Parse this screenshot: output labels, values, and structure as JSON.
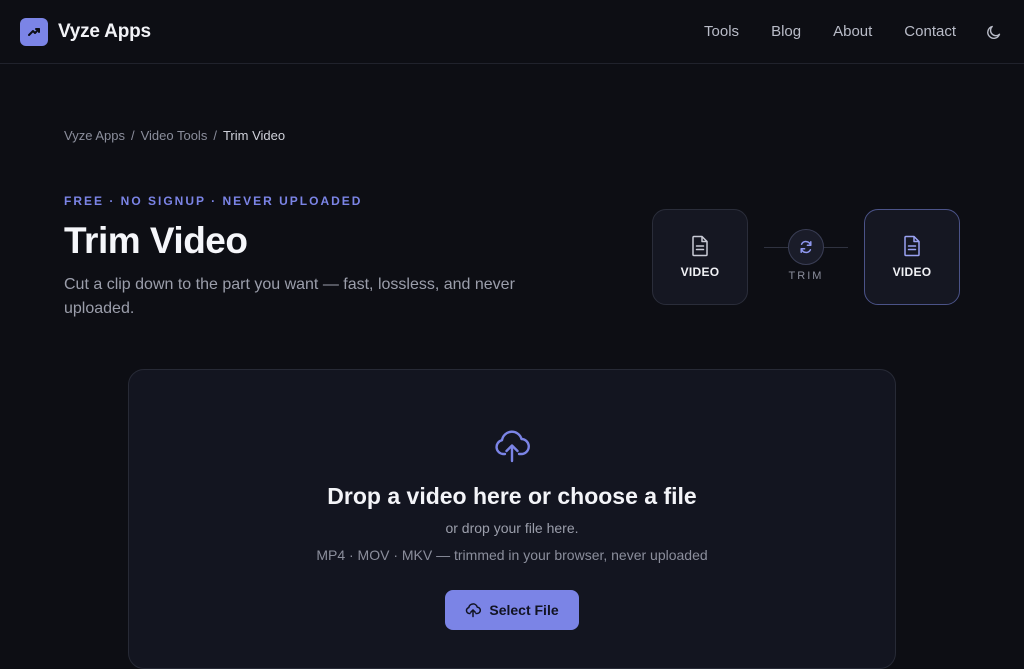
{
  "brand": {
    "name": "Vyze Apps",
    "logo_icon": "trend-arrow-icon"
  },
  "nav": {
    "items": [
      "Tools",
      "Blog",
      "About",
      "Contact"
    ],
    "theme_icon": "moon-icon"
  },
  "breadcrumb": {
    "items": [
      "Vyze Apps",
      "Video Tools",
      "Trim Video"
    ],
    "separator": "/"
  },
  "hero": {
    "eyebrow": "FREE · NO SIGNUP · NEVER UPLOADED",
    "title": "Trim Video",
    "subtitle": "Cut a clip down to the part you want — fast, lossless, and never uploaded."
  },
  "conversion": {
    "from_label": "VIDEO",
    "action_label": "TRIM",
    "to_label": "VIDEO"
  },
  "dropzone": {
    "title": "Drop a video here or choose a file",
    "subtitle": "or drop your file here.",
    "formats": "MP4 · MOV · MKV — trimmed in your browser, never uploaded",
    "button_label": "Select File"
  },
  "colors": {
    "accent": "#7b84e6",
    "background": "#0d0e14",
    "card": "#131520"
  }
}
